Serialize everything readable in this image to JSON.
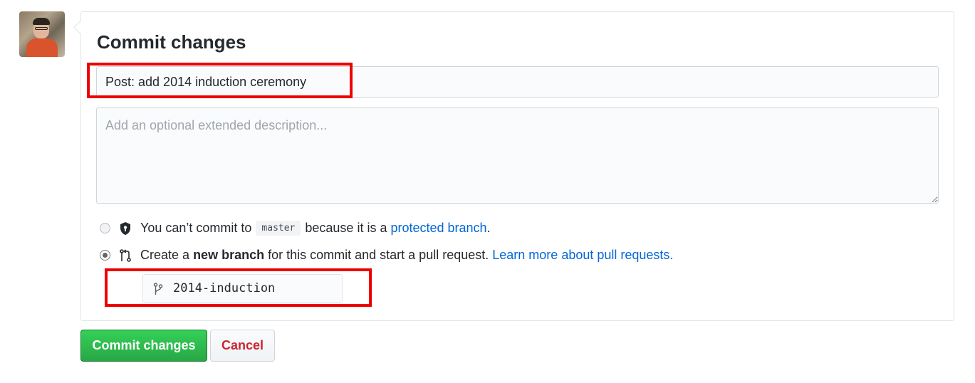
{
  "form": {
    "title": "Commit changes",
    "summary_value": "Post: add 2014 induction ceremony",
    "description_placeholder": "Add an optional extended description..."
  },
  "commit_options": {
    "direct": {
      "text_before": "You can’t commit to",
      "branch": "master",
      "text_after": "because it is a",
      "link": "protected branch",
      "end": ".",
      "icon": "shield-lock-icon",
      "selected": false
    },
    "new_branch": {
      "text_before": "Create a",
      "emphasis": "new branch",
      "text_after": "for this commit and start a pull request.",
      "link": "Learn more about pull requests.",
      "icon": "pull-request-icon",
      "selected": true
    }
  },
  "branch_name": {
    "value": "2014-induction",
    "icon": "git-branch-icon"
  },
  "buttons": {
    "commit": "Commit changes",
    "cancel": "Cancel"
  },
  "colors": {
    "primary": "#28a745",
    "cancel_text": "#cb2431",
    "link": "#0366d6",
    "highlight": "#ee0000"
  }
}
